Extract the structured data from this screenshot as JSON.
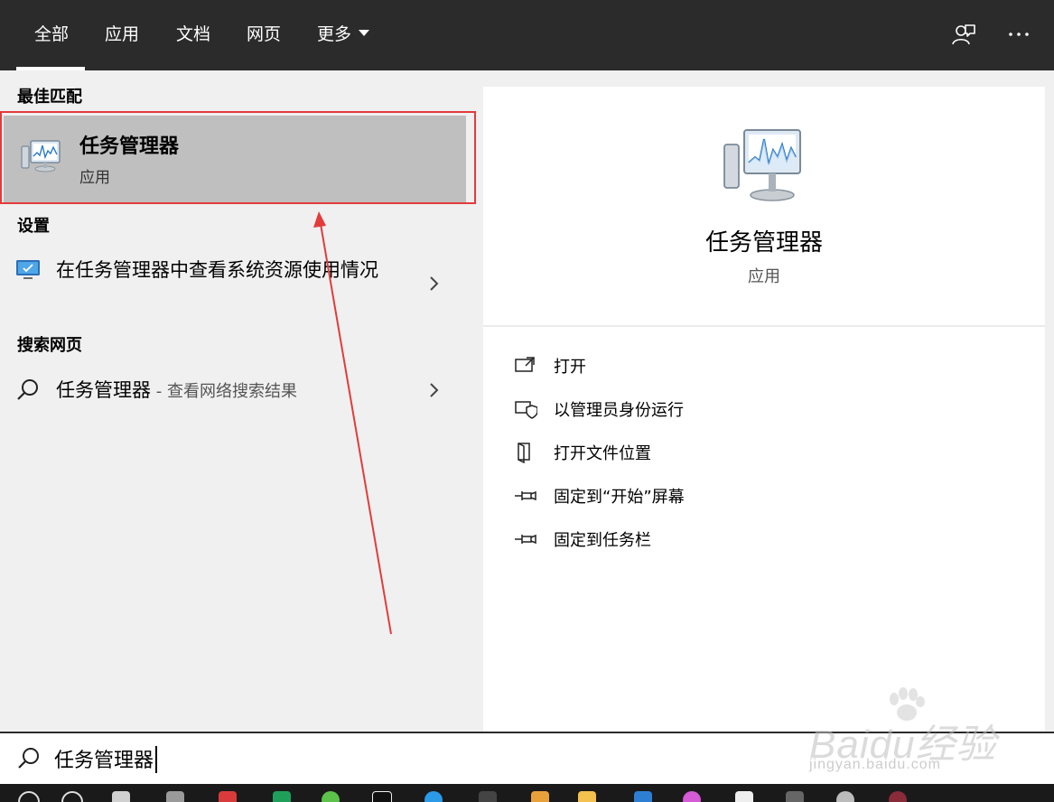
{
  "tabs": [
    {
      "label": "全部",
      "active": true
    },
    {
      "label": "应用"
    },
    {
      "label": "文档"
    },
    {
      "label": "网页"
    },
    {
      "label": "更多"
    }
  ],
  "header_icons": [
    "feedback-icon",
    "more-options-icon"
  ],
  "sections": {
    "best_match": "最佳匹配",
    "settings": "设置",
    "web_search": "搜索网页"
  },
  "best_match_item": {
    "name": "任务管理器",
    "type": "应用",
    "icon": "task-manager-icon"
  },
  "settings_item": {
    "label": "在任务管理器中查看系统资源使用情况",
    "icon": "monitor-icon"
  },
  "web_item": {
    "query": "任务管理器",
    "suffix": " - 查看网络搜索结果",
    "icon": "search-icon"
  },
  "detail": {
    "title": "任务管理器",
    "subtitle": "应用",
    "actions": [
      {
        "label": "打开",
        "icon": "open-icon"
      },
      {
        "label": "以管理员身份运行",
        "icon": "shield-icon"
      },
      {
        "label": "打开文件位置",
        "icon": "file-location-icon"
      },
      {
        "label": "固定到“开始”屏幕",
        "icon": "pin-icon"
      },
      {
        "label": "固定到任务栏",
        "icon": "pin-icon"
      }
    ]
  },
  "search": {
    "value": "任务管理器"
  },
  "watermark": {
    "brand": "Baidu经验",
    "url": "jingyan.baidu.com"
  },
  "colors": {
    "topbar": "#2b2b2b",
    "highlight": "#bfbfbf",
    "annotation": "#e33b3b"
  }
}
